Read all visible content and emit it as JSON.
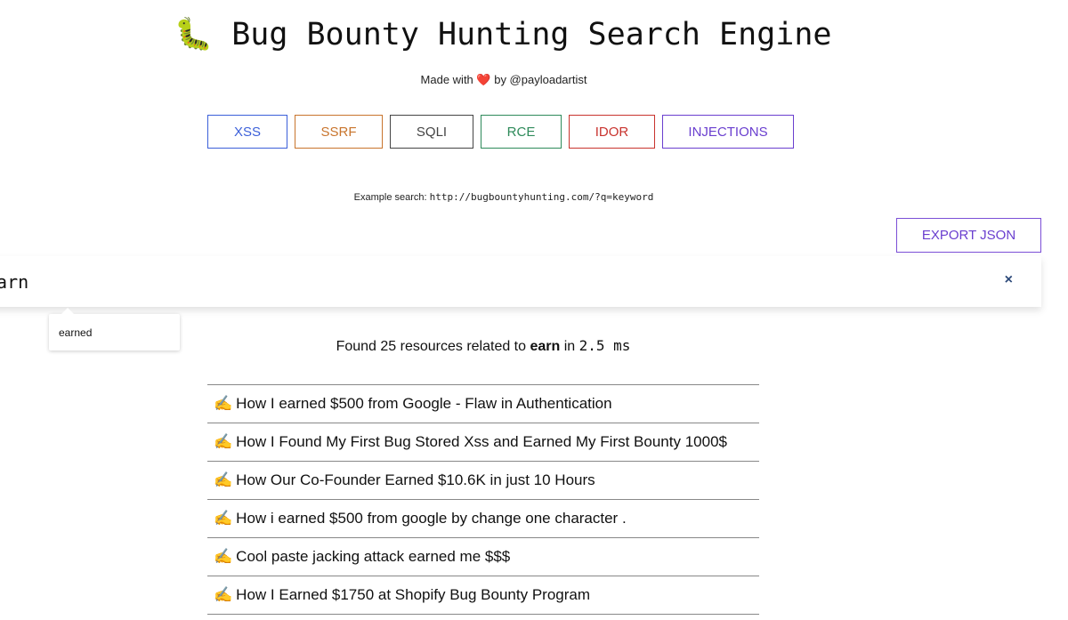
{
  "header": {
    "logo_icon": "caterpillar-icon",
    "logo_emoji": "🐛",
    "title": "Bug Bounty Hunting Search Engine",
    "made_with": "Made with",
    "heart": "❤️",
    "by": "by @payloadartist"
  },
  "categories": [
    {
      "label": "XSS",
      "color": "#3b5fd9",
      "width": 90
    },
    {
      "label": "SSRF",
      "color": "#c8742c",
      "width": 99
    },
    {
      "label": "SQLI",
      "color": "#444444",
      "width": 94
    },
    {
      "label": "RCE",
      "color": "#2e8a5a",
      "width": 91
    },
    {
      "label": "IDOR",
      "color": "#c8332e",
      "width": 97
    },
    {
      "label": "INJECTIONS",
      "color": "#6a3fcf",
      "width": 148
    }
  ],
  "example": {
    "label": "Example search:",
    "url": "http://bugbountyhunting.com/?q=keyword"
  },
  "export_label": "EXPORT JSON",
  "search": {
    "value": "earn",
    "clear": "×",
    "suggestion": "earned"
  },
  "found": {
    "prefix": "Found 25 resources related to",
    "keyword": "earn",
    "in": "in",
    "time": "2.5 ms"
  },
  "results": [
    {
      "icon": "✍️",
      "title": "How I earned $500 from Google - Flaw in Authentication"
    },
    {
      "icon": "✍️",
      "title": "How I Found My First Bug Stored Xss and Earned My First Bounty 1000$"
    },
    {
      "icon": "✍️",
      "title": "How Our Co-Founder Earned $10.6K in just 10 Hours"
    },
    {
      "icon": "✍️",
      "title": "How i earned $500 from google by change one character ."
    },
    {
      "icon": "✍️",
      "title": "Cool paste jacking attack earned me $$$"
    },
    {
      "icon": "✍️",
      "title": "How I Earned $1750 at Shopify Bug Bounty Program"
    }
  ]
}
